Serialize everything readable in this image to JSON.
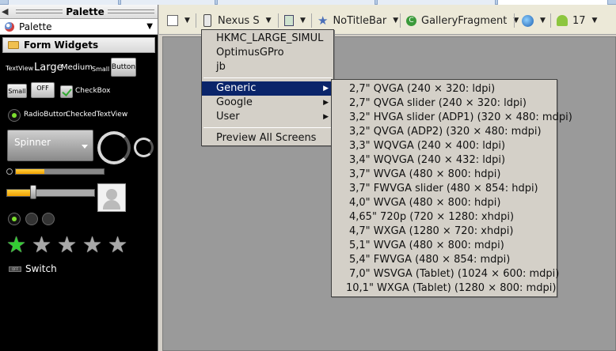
{
  "palette": {
    "title": "Palette",
    "header_label": "Palette",
    "section": "Form Widgets",
    "widgets": {
      "textview": "TextView",
      "large": "Large",
      "medium": "Medium",
      "small": "Small",
      "button": "Button",
      "small_button": "Small",
      "toggle_off": "OFF",
      "checkbox": "CheckBox",
      "radiobutton": "RadioButton",
      "checkedtextview": "CheckedTextView",
      "spinner": "Spinner",
      "switch": "Switch",
      "switch_small": "OFF"
    },
    "progress_fraction": 0.32,
    "seek_fraction": 0.3,
    "rating": {
      "filled": 1,
      "total": 5
    }
  },
  "toolbar": {
    "device": "Nexus S",
    "theme": "NoTitleBar",
    "activity": "GalleryFragment",
    "api": "17"
  },
  "device_menu": {
    "items": [
      "HKMC_LARGE_SIMUL",
      "OptimusGPro",
      "jb"
    ],
    "submenus": [
      "Generic",
      "Google",
      "User"
    ],
    "selected": "Generic",
    "preview": "Preview All Screens"
  },
  "generic_menu": {
    "items": [
      "2,7\" QVGA (240 × 320: ldpi)",
      "2,7\" QVGA slider (240 × 320: ldpi)",
      "3,2\" HVGA slider (ADP1) (320 × 480: mdpi)",
      "3,2\" QVGA (ADP2) (320 × 480: mdpi)",
      "3,3\" WQVGA (240 × 400: ldpi)",
      "3,4\" WQVGA (240 × 432: ldpi)",
      "3,7\" WVGA (480 × 800: hdpi)",
      "3,7\" FWVGA slider (480 × 854: hdpi)",
      "4,0\" WVGA (480 × 800: hdpi)",
      "4,65\" 720p (720 × 1280: xhdpi)",
      "4,7\" WXGA (1280 × 720: xhdpi)",
      "5,1\" WVGA (480 × 800: mdpi)",
      "5,4\" FWVGA (480 × 854: mdpi)",
      "7,0\" WSVGA (Tablet) (1024 × 600: mdpi)",
      "10,1\" WXGA (Tablet) (1280 × 800: mdpi)"
    ]
  }
}
